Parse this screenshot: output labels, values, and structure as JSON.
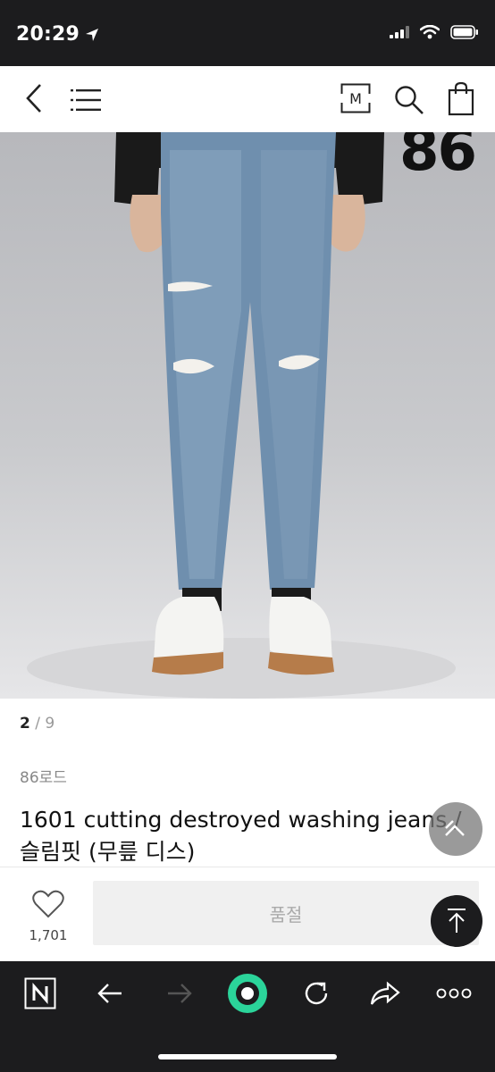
{
  "status": {
    "time": "20:29"
  },
  "nav": {
    "back_icon": "chevron-left-icon",
    "menu_icon": "hamburger-icon",
    "m_label": "M",
    "search_icon": "search-icon",
    "bag_icon": "shopping-bag-icon"
  },
  "hero": {
    "brand_mark": "86",
    "photo_alt": "model wearing light-wash destroyed slim jeans with white sneakers"
  },
  "gallery": {
    "current": "2",
    "separator": "/",
    "total": "9"
  },
  "product": {
    "brand": "86로드",
    "title": "1601 cutting destroyed washing jeans / 슬림핏 (무릎 디스)"
  },
  "actions": {
    "like_count": "1,701",
    "soldout_label": "품절"
  },
  "colors": {
    "accent_green": "#2bd49a",
    "dark": "#1c1c1e",
    "float_gray": "#8a8a8a"
  }
}
